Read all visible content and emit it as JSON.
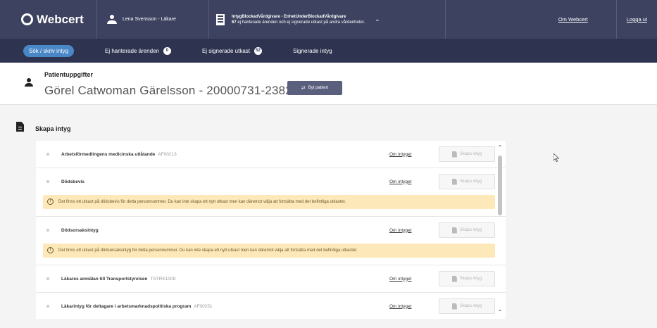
{
  "header": {
    "brand": "Webcert",
    "user": "Lena Svensson - Läkare",
    "unit_name": "IntygBlockadVårdgivare - EnhetUnderBlockadVårdgivare",
    "unit_sub_count": "67",
    "unit_sub": "ej hanterade ärenden och ej signerade utkast på andra vårdenheter.",
    "link_about": "Om Webcert",
    "link_logout": "Logga ut"
  },
  "tabs": [
    {
      "label": "Sök / skriv intyg",
      "badge": ""
    },
    {
      "label": "Ej hanterade ärenden",
      "badge": "0"
    },
    {
      "label": "Ej signerade utkast",
      "badge": "52"
    },
    {
      "label": "Signerade intyg",
      "badge": ""
    }
  ],
  "patient": {
    "label": "Patientuppgifter",
    "name": "Görel Catwoman Gärelsson - 20000731-2382",
    "switch_button": "Byt patient"
  },
  "section": {
    "title": "Skapa intyg",
    "about_link": "Om intyget",
    "create_button": "Skapa intyg"
  },
  "items": [
    {
      "name": "Arbetsförmedlingens medicinska utlåtande",
      "code": "AF00213",
      "warning": ""
    },
    {
      "name": "Dödsbevis",
      "code": "",
      "warning": "Det finns ett utkast på dödsbevis för detta personnummer. Du kan inte skapa ett nytt utkast men kan däremot välja att fortsätta med det befintliga utkastet."
    },
    {
      "name": "Dödsorsaksintyg",
      "code": "",
      "warning": "Det finns ett utkast på dödsorsaksintyg för detta personnummer. Du kan inte skapa ett nytt utkast men kan däremot välja att fortsätta med det befintliga utkastet."
    },
    {
      "name": "Läkares anmälan till Transportstyrelsen",
      "code": "TSTRK1009",
      "warning": ""
    },
    {
      "name": "Läkarintyg för deltagare i arbetsmarknadspolitiska program",
      "code": "AF00251",
      "warning": ""
    }
  ]
}
